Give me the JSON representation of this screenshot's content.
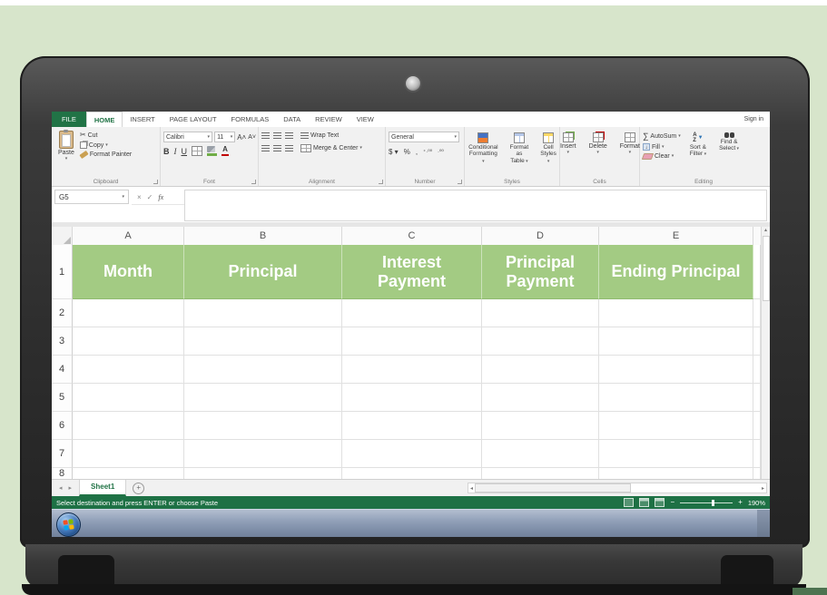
{
  "window": {
    "sign_in": "Sign in"
  },
  "tabs": {
    "file": "FILE",
    "items": [
      "HOME",
      "INSERT",
      "PAGE LAYOUT",
      "FORMULAS",
      "DATA",
      "REVIEW",
      "VIEW"
    ]
  },
  "ribbon": {
    "clipboard": {
      "group": "Clipboard",
      "paste": "Paste",
      "cut": "Cut",
      "copy": "Copy",
      "format_painter": "Format Painter"
    },
    "font": {
      "group": "Font",
      "name": "Calibri",
      "size": "11"
    },
    "alignment": {
      "group": "Alignment",
      "wrap": "Wrap Text",
      "merge": "Merge & Center"
    },
    "number": {
      "group": "Number",
      "format": "General"
    },
    "styles": {
      "group": "Styles",
      "conditional_1": "Conditional",
      "conditional_2": "Formatting",
      "table_1": "Format as",
      "table_2": "Table",
      "cellstyles_1": "Cell",
      "cellstyles_2": "Styles"
    },
    "cells": {
      "group": "Cells",
      "insert": "Insert",
      "delete": "Delete",
      "format": "Format"
    },
    "editing": {
      "group": "Editing",
      "autosum": "AutoSum",
      "fill": "Fill",
      "clear": "Clear",
      "sort_1": "Sort &",
      "sort_2": "Filter",
      "find_1": "Find &",
      "find_2": "Select"
    }
  },
  "formula_bar": {
    "name_box": "G5"
  },
  "grid": {
    "columns": [
      "A",
      "B",
      "C",
      "D",
      "E"
    ],
    "rows": [
      "1",
      "2",
      "3",
      "4",
      "5",
      "6",
      "7",
      "8"
    ],
    "headers": [
      "Month",
      "Principal",
      "Interest Payment",
      "Principal Payment",
      "Ending Principal"
    ]
  },
  "sheet_bar": {
    "sheet_name": "Sheet1"
  },
  "status_bar": {
    "message": "Select destination and press ENTER or choose Paste",
    "zoom_level": "190%"
  },
  "colors": {
    "excel_green": "#217346",
    "header_fill": "#a3cb83",
    "status_green": "#1e7145",
    "taskbar_blue": "#8b9ab3",
    "background_green": "#d7e5cb"
  }
}
